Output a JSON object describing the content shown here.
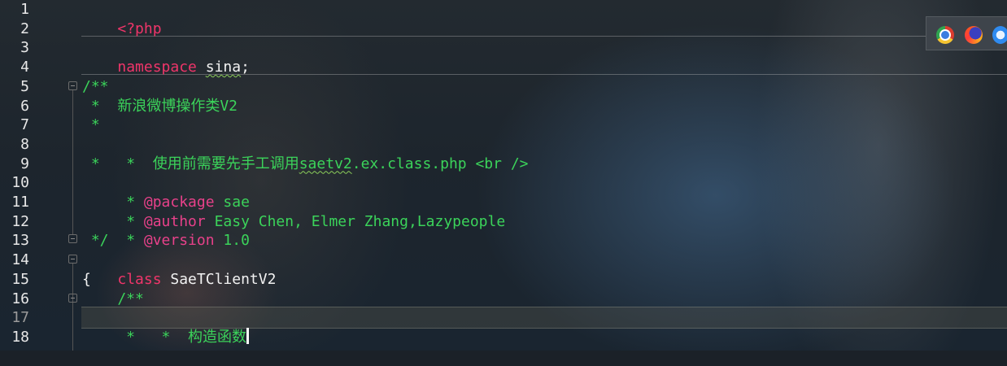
{
  "editor": {
    "line_numbers": [
      "1",
      "2",
      "3",
      "4",
      "5",
      "6",
      "7",
      "8",
      "9",
      "10",
      "11",
      "12",
      "13",
      "14",
      "15",
      "16",
      "17",
      "18"
    ],
    "current_line": "17",
    "lines": {
      "l1": {
        "open_tag": "<?php"
      },
      "l3": {
        "keyword": "namespace",
        "name": "sina",
        "end": ";"
      },
      "l5": {
        "text": "/**"
      },
      "l6": {
        "text": " *  新浪微博操作类V2"
      },
      "l7": {
        "text": " *"
      },
      "l8": {
        "prefix": " *  使用前需要先手工调用",
        "link": "saetv2",
        "rest": ".ex.class.php <br />"
      },
      "l9": {
        "text": " *"
      },
      "l10": {
        "star": " * ",
        "tag": "@package",
        "value": " sae"
      },
      "l11": {
        "star": " * ",
        "tag": "@author",
        "value": " Easy Chen, Elmer Zhang,Lazypeople"
      },
      "l12": {
        "star": " * ",
        "tag": "@version",
        "value": " 1.0"
      },
      "l13": {
        "text": " */"
      },
      "l14": {
        "keyword": "class",
        "name": " SaeTClientV2"
      },
      "l15": {
        "text": "{"
      },
      "l16": {
        "text": "    /**"
      },
      "l17": {
        "text": "     *  构造函数"
      },
      "l18": {
        "text": "     *"
      }
    }
  },
  "browser_icons": [
    "chrome-icon",
    "firefox-icon",
    "safari-icon"
  ],
  "colors": {
    "keyword": "#f0356a",
    "comment": "#3bd35a",
    "doc_tag": "#e8418a",
    "text": "#f2f2f2"
  }
}
